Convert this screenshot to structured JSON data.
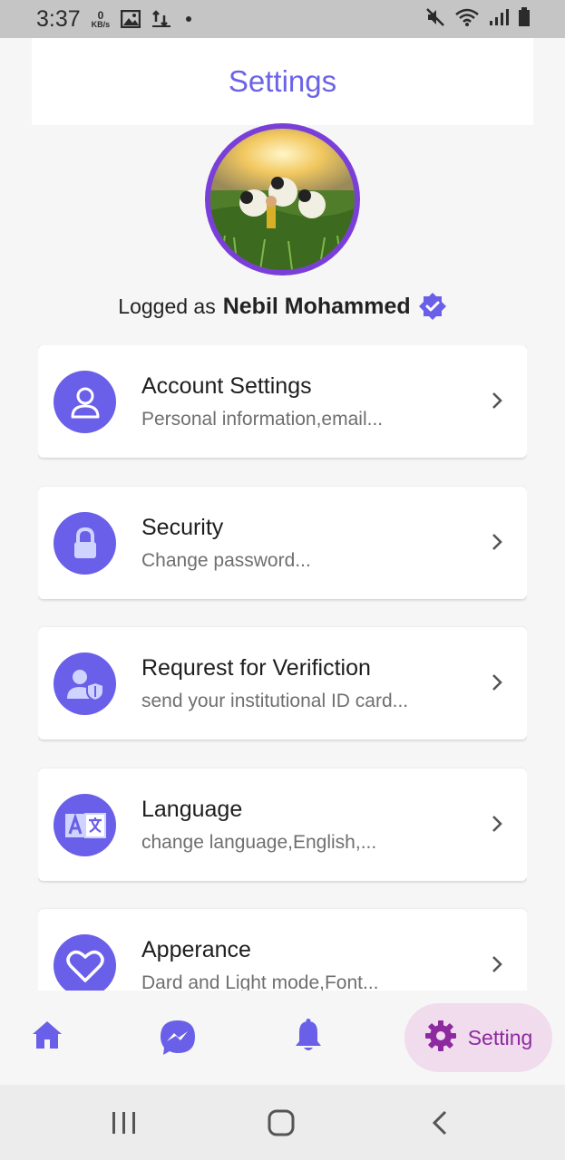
{
  "status_bar": {
    "time": "3:37",
    "net_speed_value": "0",
    "net_speed_unit": "KB/s",
    "icons": [
      "gallery-icon",
      "transfer-icon",
      "dot-icon",
      "mute-icon",
      "wifi-icon",
      "signal-icon",
      "battery-icon"
    ]
  },
  "header": {
    "title": "Settings"
  },
  "profile": {
    "logged_prefix": "Logged as",
    "name": "Nebil Mohammed",
    "verified_icon": "verified-badge-icon"
  },
  "settings_items": [
    {
      "title": "Account Settings",
      "subtitle": "Personal information,email...",
      "icon": "user-icon"
    },
    {
      "title": "Security",
      "subtitle": "Change password...",
      "icon": "lock-icon"
    },
    {
      "title": "Requrest for Verifiction",
      "subtitle": "send your institutional ID card...",
      "icon": "user-shield-icon"
    },
    {
      "title": "Language",
      "subtitle": "change language,English,...",
      "icon": "translate-icon"
    },
    {
      "title": "Apperance",
      "subtitle": "Dard and Light mode,Font...",
      "icon": "heart-icon"
    }
  ],
  "bottom_nav": {
    "items": [
      {
        "icon": "home-icon"
      },
      {
        "icon": "messenger-icon"
      },
      {
        "icon": "bell-icon"
      },
      {
        "icon": "gear-icon",
        "label": "Setting",
        "active": true
      }
    ]
  },
  "colors": {
    "accent": "#6a5fe8",
    "title": "#6b63e6",
    "avatar_ring": "#7a3fd8",
    "active_nav_bg": "#f0dced",
    "active_nav_fg": "#8e2aa0"
  }
}
